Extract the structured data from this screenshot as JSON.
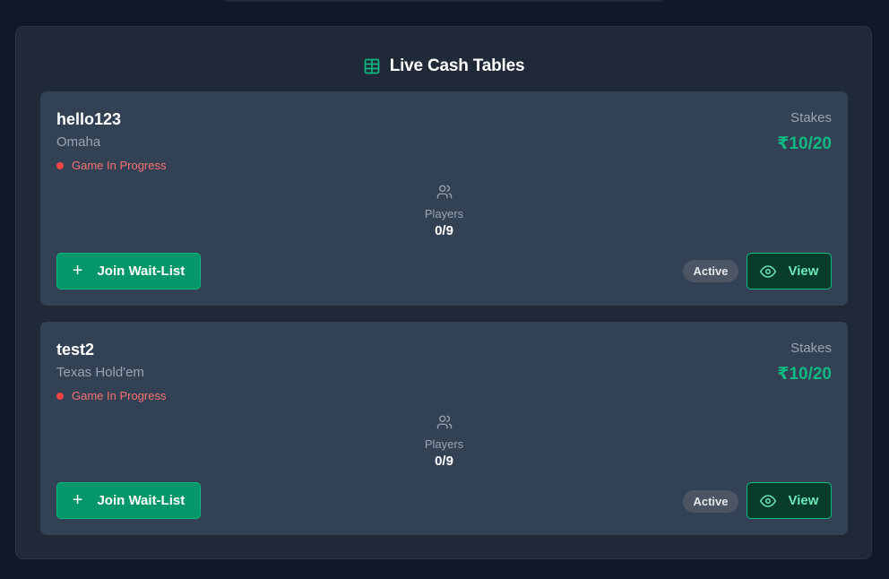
{
  "header": {
    "title": "Live Cash Tables",
    "icon": "table-grid-icon"
  },
  "tables": [
    {
      "name": "hello123",
      "game_type": "Omaha",
      "status": "Game In Progress",
      "stakes_label": "Stakes",
      "stakes": "₹10/20",
      "players_label": "Players",
      "players": "0/9",
      "join_label": "Join Wait-List",
      "badge": "Active",
      "view_label": "View"
    },
    {
      "name": "test2",
      "game_type": "Texas Hold'em",
      "status": "Game In Progress",
      "stakes_label": "Stakes",
      "stakes": "₹10/20",
      "players_label": "Players",
      "players": "0/9",
      "join_label": "Join Wait-List",
      "badge": "Active",
      "view_label": "View"
    }
  ],
  "colors": {
    "accent": "#10b981",
    "status": "#ef4444",
    "background": "#111827",
    "card": "#334155"
  }
}
